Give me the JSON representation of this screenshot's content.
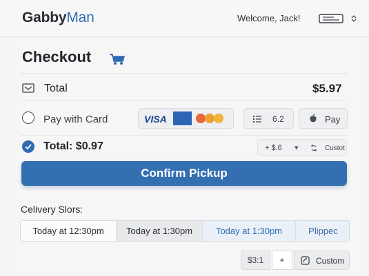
{
  "header": {
    "brand_part1": "Gabby",
    "brand_part2": "Man",
    "welcome": "Welcome, Jack!",
    "menu_icon": "menu-icon",
    "chevron_icon": "chevron-updown-icon"
  },
  "checkout": {
    "title": "Checkout",
    "cart_icon": "cart-icon",
    "total_label": "Total",
    "total_amount": "$5.97",
    "pay_with_card": "Pay with Card",
    "card_brands": [
      "VISA",
      "AMEX",
      "Mastercard"
    ],
    "wallet_value": "6.2",
    "apple_pay": "Pay",
    "selected_total": "Total: $0.97",
    "adjust_value": "+ $.6",
    "adjust_caret": "▾",
    "adjust_custom": "Custot",
    "confirm_button": "Confirm Pickup"
  },
  "delivery": {
    "label": "Celivery Slors:",
    "slots": [
      "Today at 12:30pm",
      "Today at 1:30pm",
      "Today at 1:30pm",
      "Plippec"
    ],
    "amount": "$3:1",
    "plus": "+",
    "custom": "Custom"
  },
  "colors": {
    "accent": "#346fb1",
    "brand_blue": "#2f6db3"
  }
}
